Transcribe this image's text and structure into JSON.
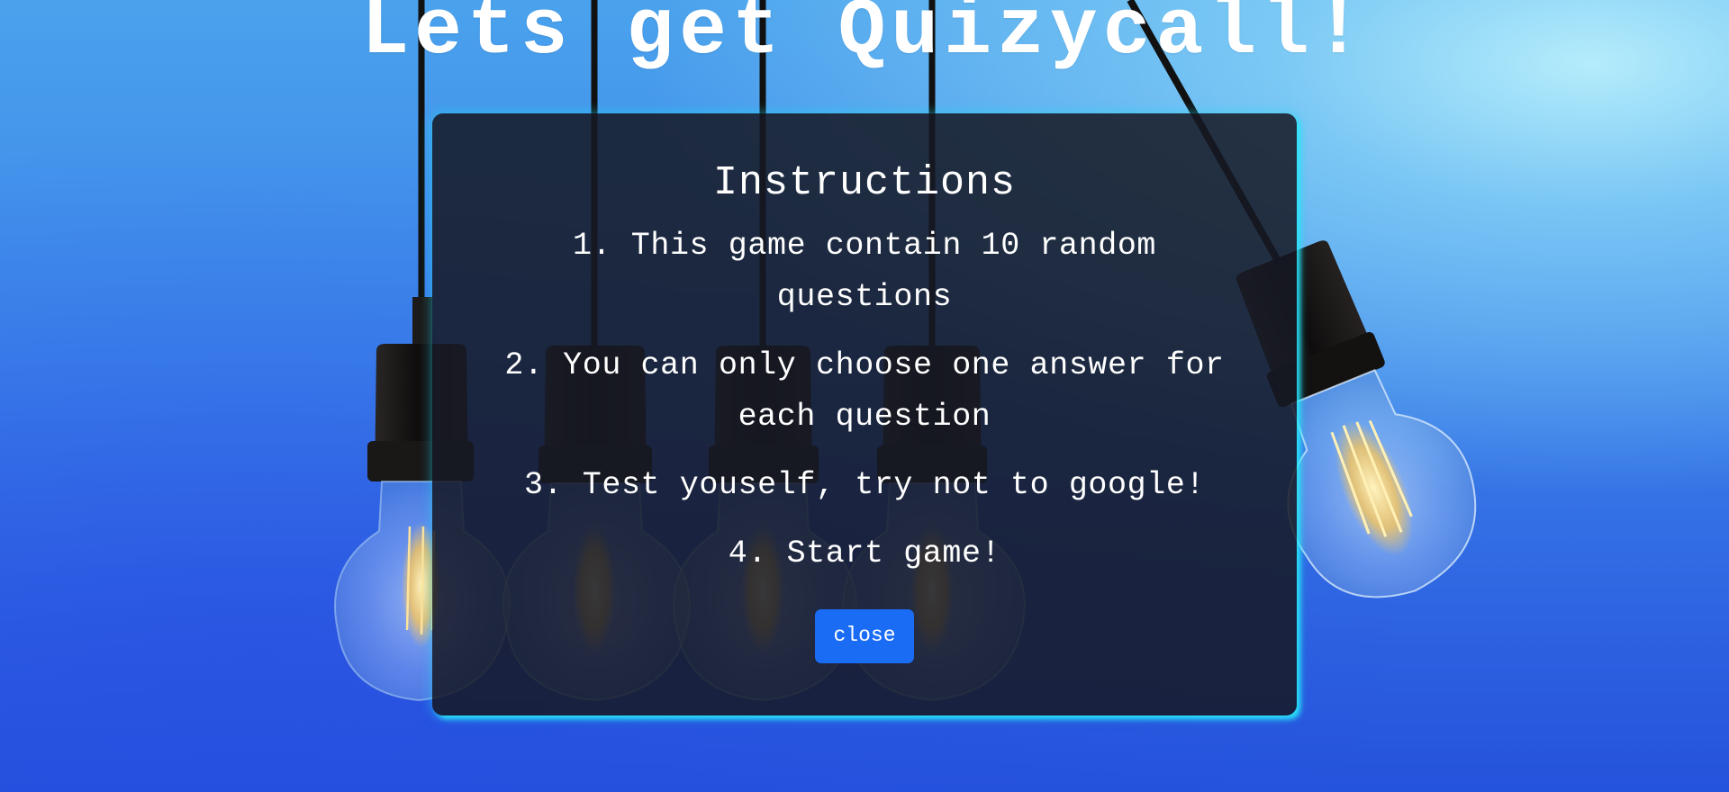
{
  "page": {
    "title": "Lets get Quizycall!"
  },
  "modal": {
    "heading": "Instructions",
    "instructions": [
      "1. This game contain 10 random questions",
      "2. You can only choose one answer for each question",
      "3. Test youself, try not to google!",
      "4. Start game!"
    ],
    "close_label": "close"
  },
  "theme": {
    "background_top": "#4aa2ec",
    "background_bottom": "#2553dc",
    "modal_glow": "#28e6fa",
    "button_color": "#1a6cf5"
  },
  "icons": [
    "light-bulb-icon",
    "light-bulb-icon",
    "light-bulb-icon",
    "light-bulb-icon",
    "light-bulb-icon"
  ]
}
